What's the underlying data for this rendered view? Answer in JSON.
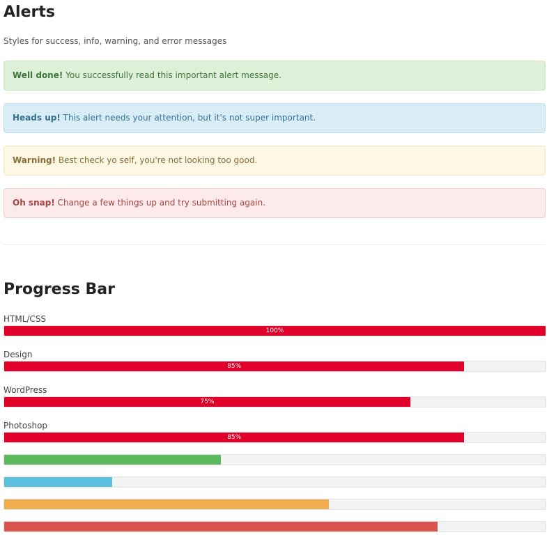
{
  "alerts": {
    "title": "Alerts",
    "subtitle": "Styles for success, info, warning, and error messages",
    "items": [
      {
        "strong": "Well done!",
        "text": " You successfully read this important alert message."
      },
      {
        "strong": "Heads up!",
        "text": " This alert needs your attention, but it's not super important."
      },
      {
        "strong": "Warning!",
        "text": " Best check yo self, you're not looking too good."
      },
      {
        "strong": "Oh snap!",
        "text": " Change a few things up and try submitting again."
      }
    ]
  },
  "progress": {
    "title": "Progress Bar",
    "skills": [
      {
        "label": "HTML/CSS",
        "value": 100,
        "value_text": "100%",
        "color": "#e0002a"
      },
      {
        "label": "Design",
        "value": 85,
        "value_text": "85%",
        "color": "#e0002a"
      },
      {
        "label": "WordPress",
        "value": 75,
        "value_text": "75%",
        "color": "#e0002a"
      },
      {
        "label": "Photoshop",
        "value": 85,
        "value_text": "85%",
        "color": "#e0002a"
      }
    ],
    "plain_bars": [
      {
        "value": 40,
        "color": "#5cb85c"
      },
      {
        "value": 20,
        "color": "#5bc0de"
      },
      {
        "value": 60,
        "color": "#f0ad4e"
      },
      {
        "value": 80,
        "color": "#d9534f"
      }
    ]
  }
}
